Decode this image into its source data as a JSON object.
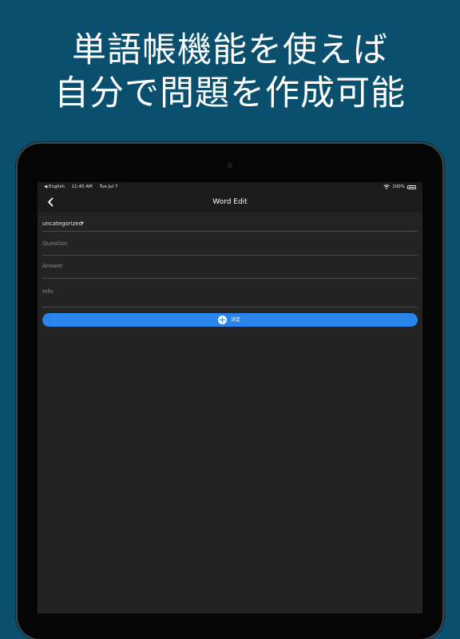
{
  "headline": {
    "line1": "単語帳機能を使えば",
    "line2": "自分で問題を作成可能"
  },
  "status_bar": {
    "back_app": "◀ English",
    "time": "11:40 AM",
    "date": "Tue Jul 7",
    "battery": "100%",
    "wifi_icon": "wifi-icon",
    "battery_icon": "battery-icon"
  },
  "nav": {
    "title": "Word Edit",
    "back_icon": "chevron-left-icon"
  },
  "form": {
    "category_value": "uncategorized",
    "question_placeholder": "Question",
    "answer_placeholder": "Answer",
    "info_placeholder": "Info",
    "submit_label": "決定",
    "submit_icon": "plus-circle-icon"
  },
  "colors": {
    "background": "#0b4f6e",
    "screen": "#242424",
    "accent": "#2b84ec"
  }
}
